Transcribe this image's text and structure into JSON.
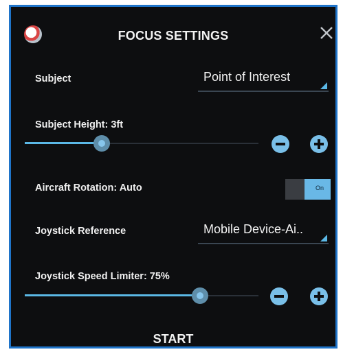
{
  "header": {
    "title": "FOCUS SETTINGS"
  },
  "subject": {
    "label": "Subject",
    "value": "Point of Interest"
  },
  "subject_height": {
    "label": "Subject Height: 3ft",
    "level": 0.33
  },
  "aircraft_rotation": {
    "label": "Aircraft Rotation: Auto",
    "toggle_label": "On",
    "toggle_state": "on"
  },
  "joystick_reference": {
    "label": "Joystick Reference",
    "value": "Mobile Device-Ai.."
  },
  "joystick_speed_limiter": {
    "label": "Joystick Speed Limiter: 75%",
    "level": 0.75
  },
  "footer": {
    "start_label": "START"
  },
  "icons": {
    "logo": "app-logo-icon",
    "close": "close-icon",
    "minus": "minus-icon",
    "plus": "plus-icon",
    "dropdown": "dropdown-triangle-icon"
  },
  "colors": {
    "accent": "#5bb8e6",
    "background": "#0d0e10",
    "frame_border": "#1f74c9"
  }
}
